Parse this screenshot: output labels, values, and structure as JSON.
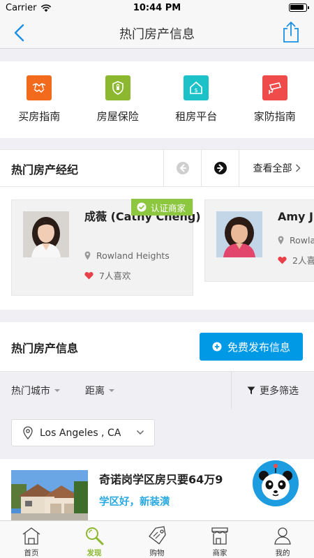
{
  "status_bar": {
    "carrier": "Carrier",
    "time": "10:44 PM"
  },
  "nav": {
    "title": "热门房产信息"
  },
  "categories": [
    {
      "label": "买房指南",
      "icon": "handshake-icon",
      "color": "#f26b1d"
    },
    {
      "label": "房屋保险",
      "icon": "shield-icon",
      "color": "#8cb82f"
    },
    {
      "label": "租房平台",
      "icon": "rental-house-icon",
      "color": "#1cc2c7"
    },
    {
      "label": "家防指南",
      "icon": "security-camera-icon",
      "color": "#f04b4b"
    }
  ],
  "agents_section": {
    "title": "热门房产经纪",
    "see_all": "查看全部",
    "agents": [
      {
        "name": "成薇 (Cathy Cheng)",
        "location": "Rowland Heights",
        "likes": "7人喜欢",
        "badge": "认证商家"
      },
      {
        "name": "Amy J",
        "location": "Rowla",
        "likes": "2人喜"
      }
    ]
  },
  "listings_section": {
    "title": "热门房产信息",
    "publish_button": "免费发布信息",
    "filters": {
      "city": "热门城市",
      "distance": "距离",
      "more": "更多筛选"
    },
    "location": "Los Angeles , CA",
    "items": [
      {
        "title": "奇诺岗学区房只要64万9",
        "subtitle": "学区好，新装潢"
      }
    ]
  },
  "tabs": [
    {
      "label": "首页",
      "icon": "home-icon",
      "active": false
    },
    {
      "label": "发现",
      "icon": "discover-icon",
      "active": true
    },
    {
      "label": "购物",
      "icon": "shopping-tag-icon",
      "active": false
    },
    {
      "label": "商家",
      "icon": "store-icon",
      "active": false
    },
    {
      "label": "我的",
      "icon": "profile-icon",
      "active": false
    }
  ],
  "colors": {
    "accent_blue": "#0099e5",
    "accent_green": "#8cb82f",
    "link_blue": "#29a9e0"
  }
}
